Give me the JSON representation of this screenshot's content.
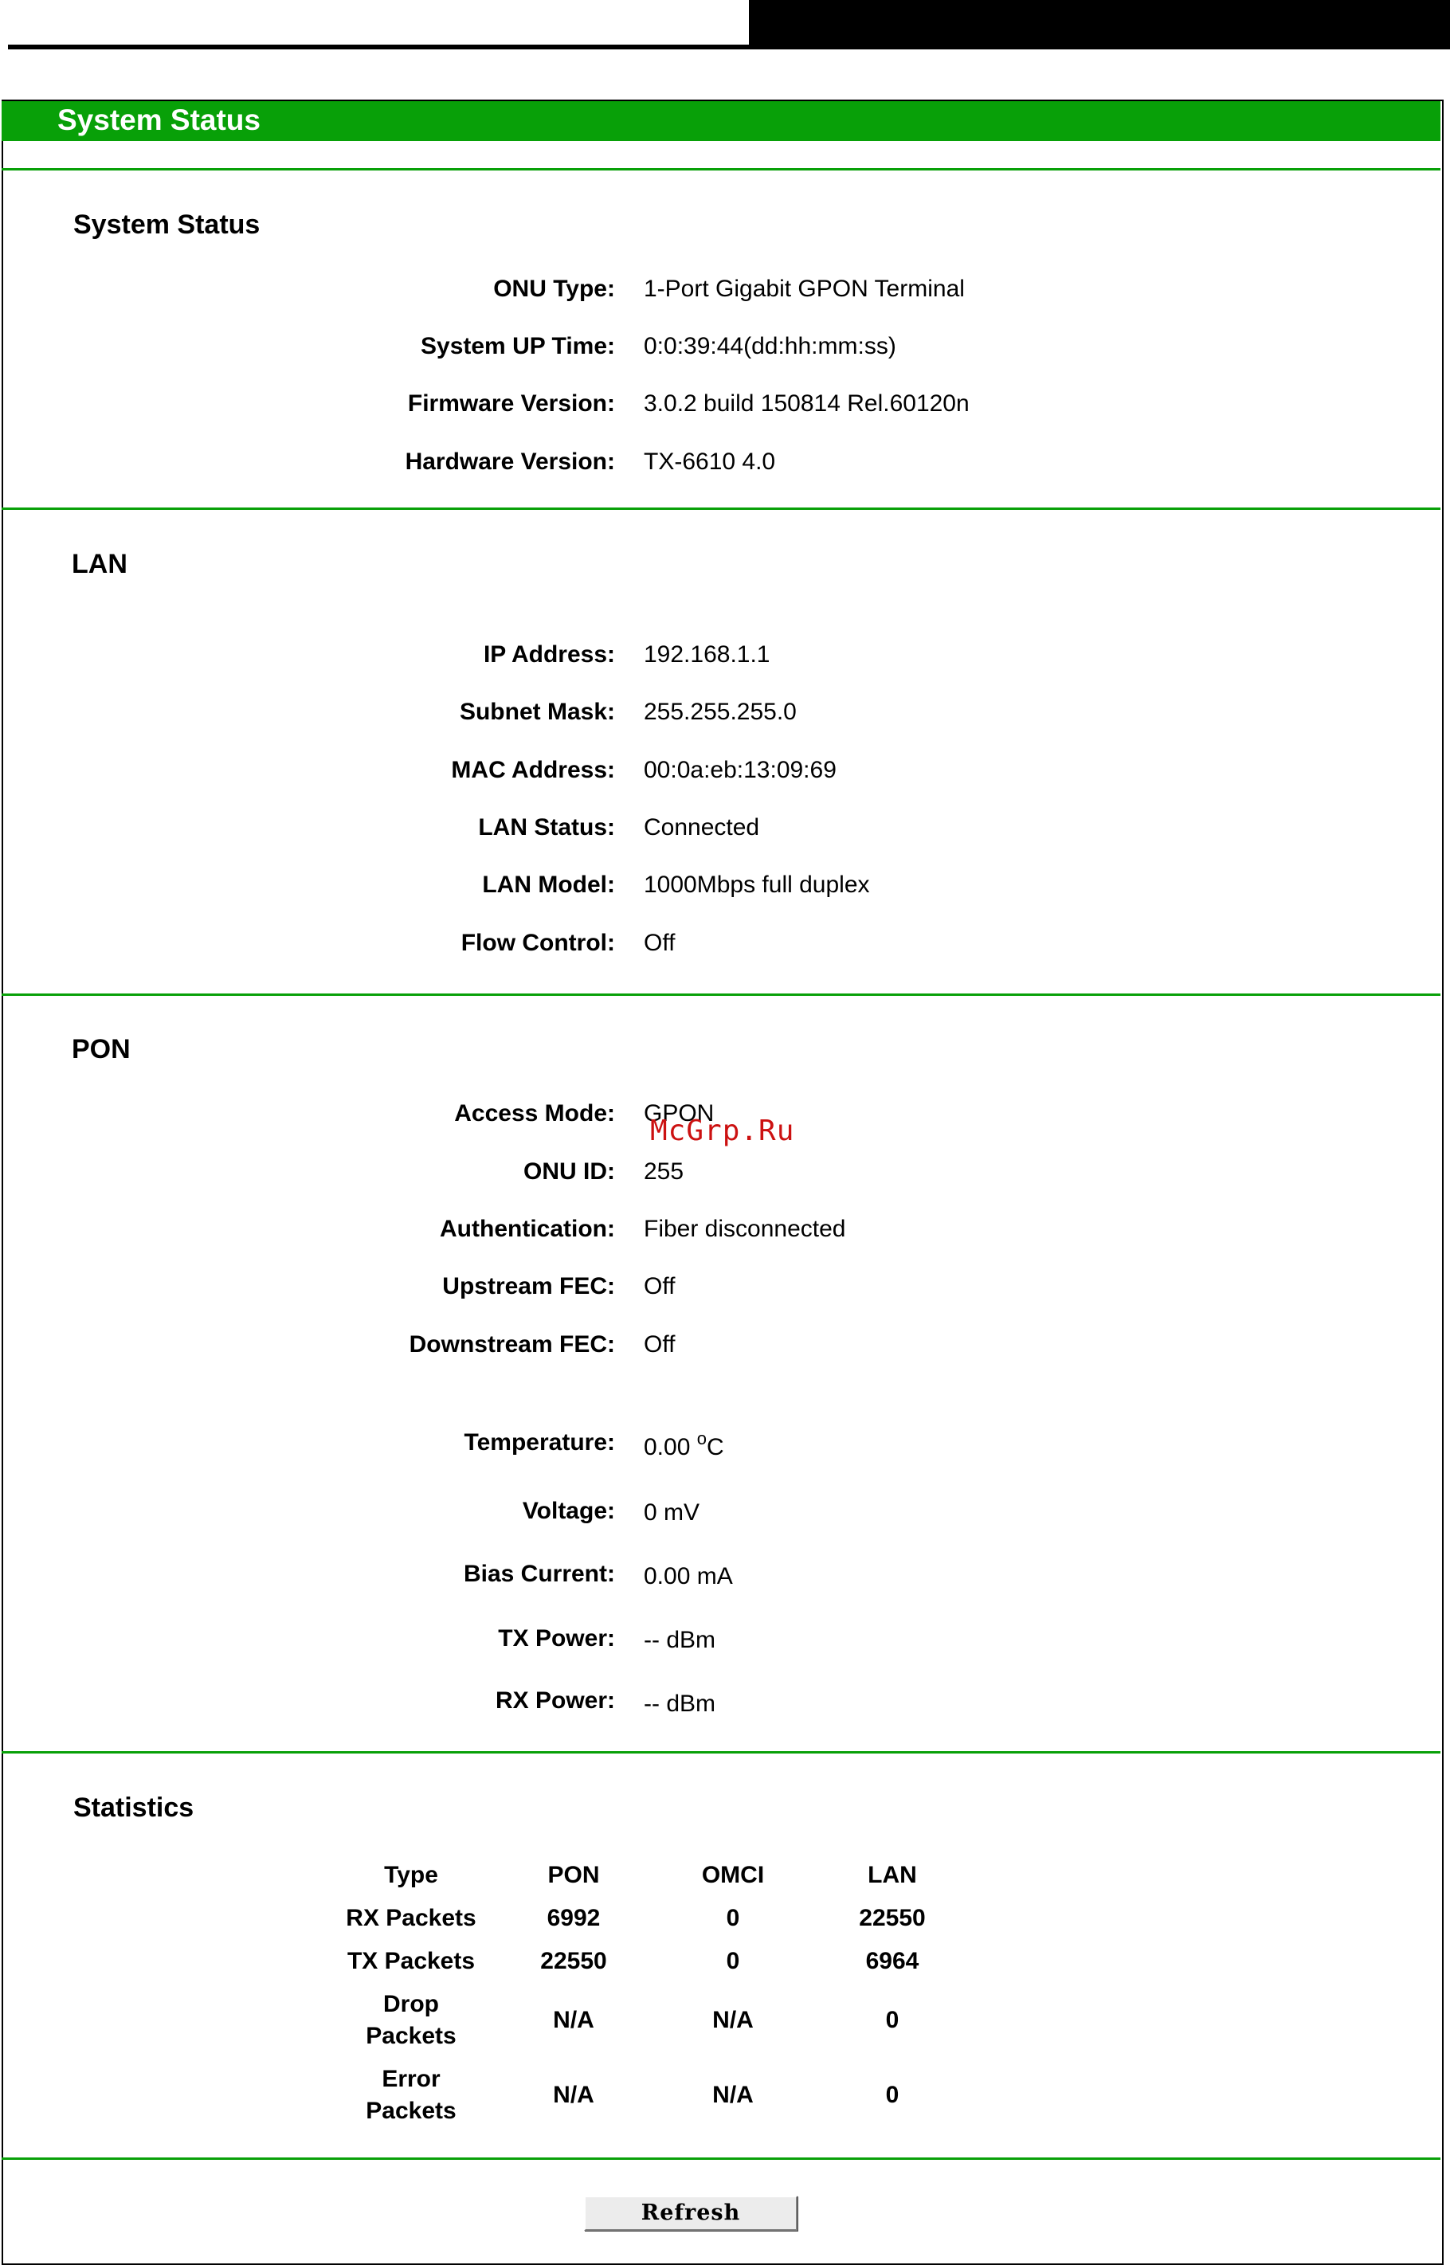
{
  "window": {
    "title": "System Status"
  },
  "system_status": {
    "heading": "System Status",
    "rows": [
      {
        "label": "ONU Type:",
        "value": "1-Port Gigabit GPON Terminal"
      },
      {
        "label": "System UP Time:",
        "value": "0:0:39:44(dd:hh:mm:ss)"
      },
      {
        "label": "Firmware Version:",
        "value": "3.0.2 build 150814 Rel.60120n"
      },
      {
        "label": "Hardware Version:",
        "value": "TX-6610 4.0"
      }
    ]
  },
  "lan": {
    "heading": "LAN",
    "rows": [
      {
        "label": "IP Address:",
        "value": "192.168.1.1"
      },
      {
        "label": "Subnet Mask:",
        "value": "255.255.255.0"
      },
      {
        "label": "MAC Address:",
        "value": "00:0a:eb:13:09:69"
      },
      {
        "label": "LAN Status:",
        "value": "Connected"
      },
      {
        "label": "LAN Model:",
        "value": "1000Mbps full duplex"
      },
      {
        "label": "Flow Control:",
        "value": "Off"
      }
    ]
  },
  "pon": {
    "heading": "PON",
    "rows": [
      {
        "label": "Access Mode:",
        "value": "GPON"
      },
      {
        "label": "ONU ID:",
        "value": "255"
      },
      {
        "label": "Authentication:",
        "value": "Fiber disconnected"
      },
      {
        "label": "Upstream FEC:",
        "value": "Off"
      },
      {
        "label": "Downstream FEC:",
        "value": "Off"
      }
    ],
    "optical": [
      {
        "label": "Temperature:",
        "value": "0.00",
        "unit_sup": "o",
        "unit": "C"
      },
      {
        "label": "Voltage:",
        "value": "0 mV"
      },
      {
        "label": "Bias Current:",
        "value": "0.00 mA"
      },
      {
        "label": "TX Power:",
        "value": "-- dBm"
      },
      {
        "label": "RX Power:",
        "value": "-- dBm"
      }
    ]
  },
  "statistics": {
    "heading": "Statistics",
    "columns": [
      "Type",
      "PON",
      "OMCI",
      "LAN"
    ],
    "rows": [
      {
        "type_line1": "RX Packets",
        "type_line2": "",
        "pon": "6992",
        "omci": "0",
        "lan": "22550"
      },
      {
        "type_line1": "TX Packets",
        "type_line2": "",
        "pon": "22550",
        "omci": "0",
        "lan": "6964"
      },
      {
        "type_line1": "Drop",
        "type_line2": "Packets",
        "pon": "N/A",
        "omci": "N/A",
        "lan": "0"
      },
      {
        "type_line1": "Error",
        "type_line2": "Packets",
        "pon": "N/A",
        "omci": "N/A",
        "lan": "0"
      }
    ]
  },
  "actions": {
    "refresh_label": "Refresh"
  },
  "watermark": "McGrp.Ru",
  "colors": {
    "accent_green": "#08a008",
    "watermark_red": "#cc1111"
  }
}
